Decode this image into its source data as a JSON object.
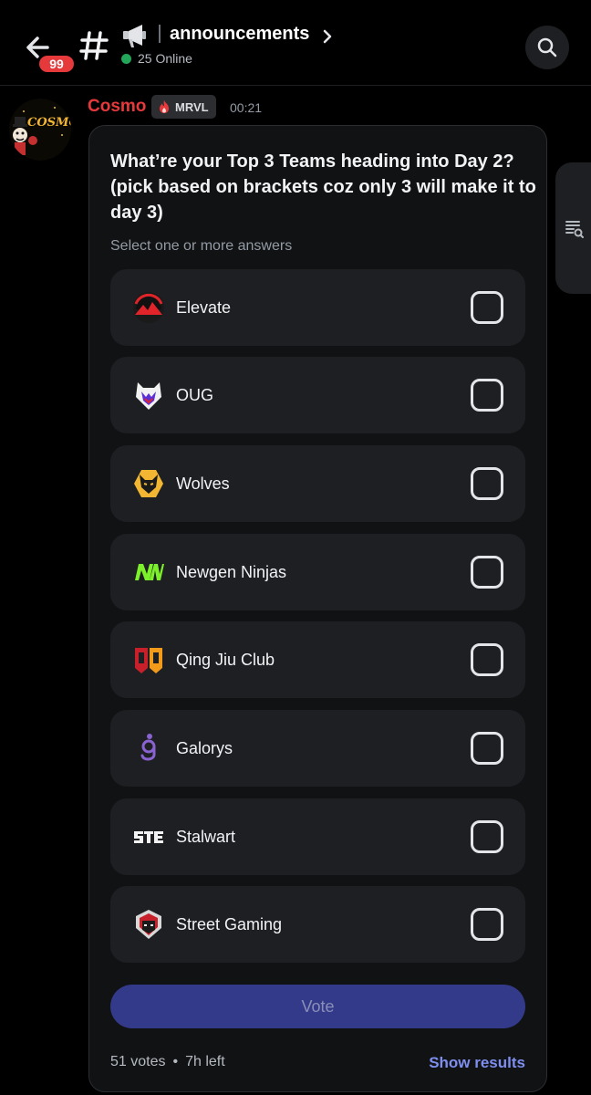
{
  "header": {
    "unread_count": "99",
    "channel_name": "announcements",
    "online_text": "25 Online"
  },
  "message": {
    "author": "Cosmo",
    "tag": "MRVL",
    "time": "00:21",
    "avatar_text": "COSMO"
  },
  "poll": {
    "question": "What’re your Top 3 Teams heading into Day 2? (pick based on brackets coz only 3 will make it to day 3)",
    "hint": "Select one or more answers",
    "options": [
      {
        "label": "Elevate",
        "icon": "elevate-logo"
      },
      {
        "label": "OUG",
        "icon": "oug-logo"
      },
      {
        "label": "Wolves",
        "icon": "wolves-logo"
      },
      {
        "label": "Newgen Ninjas",
        "icon": "newgen-ninjas-logo"
      },
      {
        "label": "Qing Jiu Club",
        "icon": "qing-jiu-club-logo"
      },
      {
        "label": "Galorys",
        "icon": "galorys-logo"
      },
      {
        "label": "Stalwart",
        "icon": "stalwart-logo"
      },
      {
        "label": "Street Gaming",
        "icon": "street-gaming-logo"
      }
    ],
    "vote_label": "Vote",
    "votes": "51 votes",
    "time_left": "7h left",
    "show_results_label": "Show results"
  },
  "colors": {
    "accent": "#7f8ff0",
    "author": "#e5393b",
    "vote_button": "#343a8a",
    "online": "#23a55a"
  }
}
